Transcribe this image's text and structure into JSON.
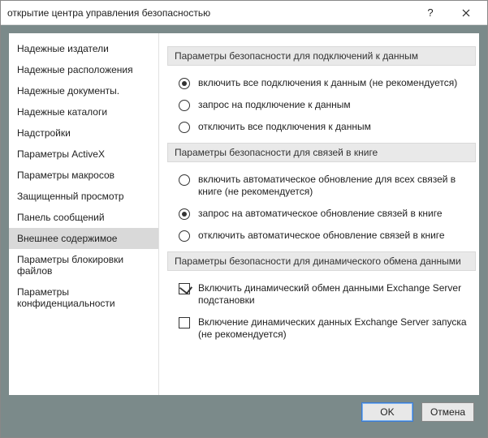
{
  "window": {
    "title": "открытие центра управления безопасностью"
  },
  "sidebar": {
    "items": [
      {
        "label": "Надежные издатели"
      },
      {
        "label": "Надежные расположения"
      },
      {
        "label": "Надежные документы."
      },
      {
        "label": "Надежные каталоги"
      },
      {
        "label": "Надстройки"
      },
      {
        "label": "Параметры ActiveX"
      },
      {
        "label": "Параметры макросов"
      },
      {
        "label": "Защищенный просмотр"
      },
      {
        "label": "Панель сообщений"
      },
      {
        "label": "Внешнее содержимое"
      },
      {
        "label": "Параметры блокировки файлов"
      },
      {
        "label": "Параметры конфиденциальности"
      }
    ]
  },
  "groups": {
    "g1": {
      "header": "Параметры безопасности для подключений к данным",
      "options": [
        {
          "label": "включить все подключения к данным (не рекомендуется)"
        },
        {
          "label": "запрос на подключение к данным"
        },
        {
          "label": "отключить все подключения к данным"
        }
      ]
    },
    "g2": {
      "header": "Параметры безопасности для связей в книге",
      "options": [
        {
          "label": "включить автоматическое обновление для всех связей в книге (не рекомендуется)"
        },
        {
          "label": "запрос на автоматическое обновление связей в книге"
        },
        {
          "label": "отключить автоматическое обновление связей в книге"
        }
      ]
    },
    "g3": {
      "header": "Параметры безопасности для динамического обмена данными",
      "options": [
        {
          "label": "Включить динамический обмен данными Exchange Server подстановки"
        },
        {
          "label": "Включение динамических данных Exchange Server запуска (не рекомендуется)"
        }
      ]
    }
  },
  "buttons": {
    "ok": "OK",
    "cancel": "Отмена"
  }
}
